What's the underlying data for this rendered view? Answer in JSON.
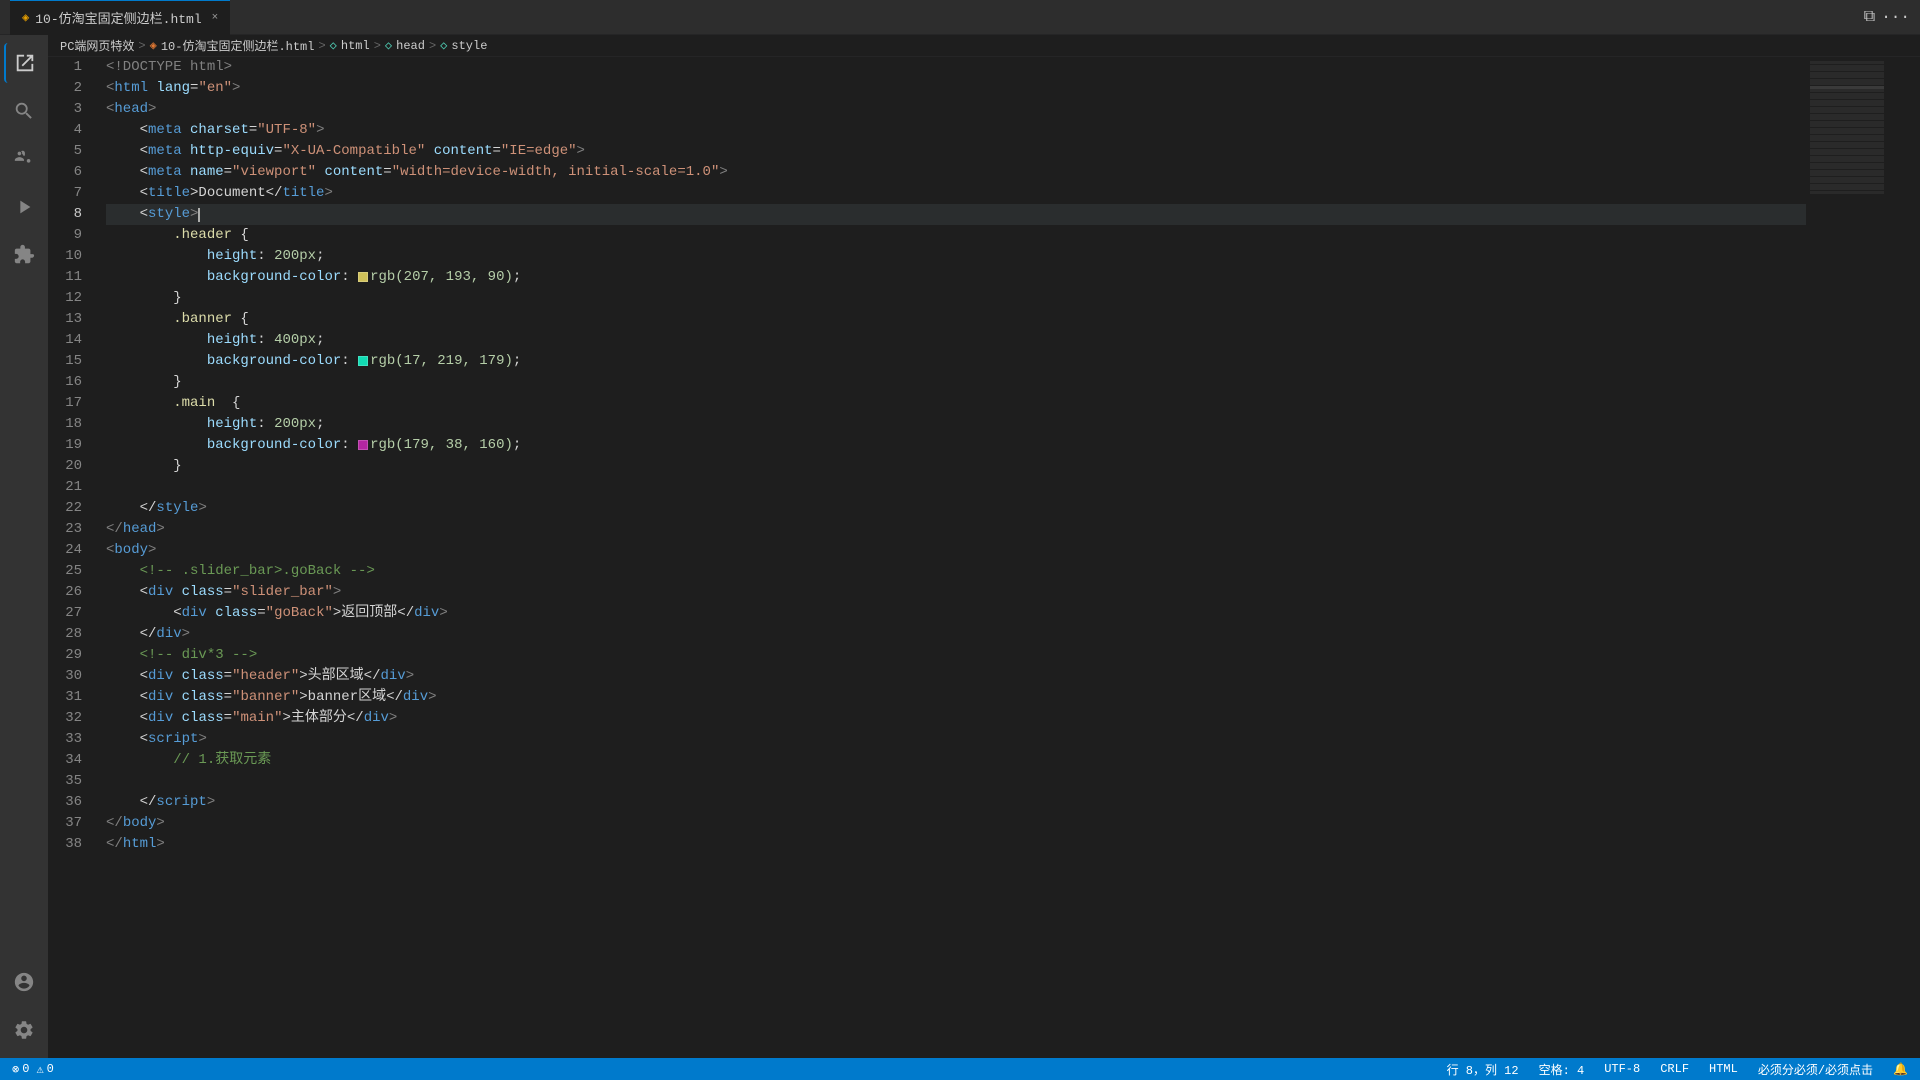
{
  "titleBar": {
    "tab": {
      "icon": "◈",
      "label": "10-仿淘宝固定侧边栏.html",
      "closeLabel": "×"
    },
    "windowControls": {
      "split": "⧉",
      "more": "···"
    }
  },
  "breadcrumb": {
    "items": [
      {
        "label": "PC端网页特效",
        "type": "folder"
      },
      {
        "label": "10-仿淘宝固定侧边栏.html",
        "type": "html"
      },
      {
        "label": "html",
        "type": "tag"
      },
      {
        "label": "head",
        "type": "tag"
      },
      {
        "label": "style",
        "type": "tag"
      }
    ]
  },
  "activityBar": {
    "icons": [
      {
        "name": "files-icon",
        "symbol": "⎗",
        "active": true
      },
      {
        "name": "search-icon",
        "symbol": "🔍"
      },
      {
        "name": "source-control-icon",
        "symbol": "⑂"
      },
      {
        "name": "run-icon",
        "symbol": "▶"
      },
      {
        "name": "extensions-icon",
        "symbol": "⊞"
      }
    ],
    "bottomIcons": [
      {
        "name": "account-icon",
        "symbol": "👤"
      },
      {
        "name": "settings-icon",
        "symbol": "⚙"
      }
    ]
  },
  "statusBar": {
    "left": {
      "errors": "⊗ 0",
      "warnings": "⚠ 0"
    },
    "right": {
      "line": "行 8，列 12",
      "spaces": "空格: 4",
      "encoding": "UTF-8",
      "crlf": "CRLF",
      "language": "HTML",
      "feedback": "必须分必须/必须点击",
      "notifications": "🔔"
    }
  },
  "lines": [
    {
      "num": 1,
      "tokens": [
        {
          "text": "<!DOCTYPE html>",
          "class": "t-gray"
        }
      ]
    },
    {
      "num": 2,
      "tokens": [
        {
          "text": "<",
          "class": "t-gray"
        },
        {
          "text": "html",
          "class": "t-blue"
        },
        {
          "text": " ",
          "class": "t-white"
        },
        {
          "text": "lang",
          "class": "t-attr"
        },
        {
          "text": "=",
          "class": "t-white"
        },
        {
          "text": "\"en\"",
          "class": "t-val"
        },
        {
          "text": ">",
          "class": "t-gray"
        }
      ]
    },
    {
      "num": 3,
      "tokens": [
        {
          "text": "<",
          "class": "t-gray"
        },
        {
          "text": "head",
          "class": "t-blue"
        },
        {
          "text": ">",
          "class": "t-gray"
        }
      ]
    },
    {
      "num": 4,
      "tokens": [
        {
          "text": "    <",
          "class": "t-white"
        },
        {
          "text": "meta",
          "class": "t-blue"
        },
        {
          "text": " ",
          "class": "t-white"
        },
        {
          "text": "charset",
          "class": "t-attr"
        },
        {
          "text": "=",
          "class": "t-white"
        },
        {
          "text": "\"UTF-8\"",
          "class": "t-val"
        },
        {
          "text": ">",
          "class": "t-gray"
        }
      ]
    },
    {
      "num": 5,
      "tokens": [
        {
          "text": "    <",
          "class": "t-white"
        },
        {
          "text": "meta",
          "class": "t-blue"
        },
        {
          "text": " ",
          "class": "t-white"
        },
        {
          "text": "http-equiv",
          "class": "t-attr"
        },
        {
          "text": "=",
          "class": "t-white"
        },
        {
          "text": "\"X-UA-Compatible\"",
          "class": "t-val"
        },
        {
          "text": " ",
          "class": "t-white"
        },
        {
          "text": "content",
          "class": "t-attr"
        },
        {
          "text": "=",
          "class": "t-white"
        },
        {
          "text": "\"IE=edge\"",
          "class": "t-val"
        },
        {
          "text": ">",
          "class": "t-gray"
        }
      ]
    },
    {
      "num": 6,
      "tokens": [
        {
          "text": "    <",
          "class": "t-white"
        },
        {
          "text": "meta",
          "class": "t-blue"
        },
        {
          "text": " ",
          "class": "t-white"
        },
        {
          "text": "name",
          "class": "t-attr"
        },
        {
          "text": "=",
          "class": "t-white"
        },
        {
          "text": "\"viewport\"",
          "class": "t-val"
        },
        {
          "text": " ",
          "class": "t-white"
        },
        {
          "text": "content",
          "class": "t-attr"
        },
        {
          "text": "=",
          "class": "t-white"
        },
        {
          "text": "\"width=device-width, initial-scale=1.0\"",
          "class": "t-val"
        },
        {
          "text": ">",
          "class": "t-gray"
        }
      ]
    },
    {
      "num": 7,
      "tokens": [
        {
          "text": "    <",
          "class": "t-white"
        },
        {
          "text": "title",
          "class": "t-blue"
        },
        {
          "text": ">Document</",
          "class": "t-white"
        },
        {
          "text": "title",
          "class": "t-blue"
        },
        {
          "text": ">",
          "class": "t-gray"
        }
      ]
    },
    {
      "num": 8,
      "tokens": [
        {
          "text": "    <",
          "class": "t-white"
        },
        {
          "text": "style",
          "class": "t-blue"
        },
        {
          "text": ">",
          "class": "t-gray"
        },
        {
          "text": "CURSOR",
          "class": "cursor-marker"
        }
      ],
      "active": true
    },
    {
      "num": 9,
      "tokens": [
        {
          "text": "        ",
          "class": "t-white"
        },
        {
          "text": ".header",
          "class": "t-yellow"
        },
        {
          "text": " {",
          "class": "t-white"
        }
      ]
    },
    {
      "num": 10,
      "tokens": [
        {
          "text": "            ",
          "class": "t-white"
        },
        {
          "text": "height",
          "class": "t-prop"
        },
        {
          "text": ": ",
          "class": "t-white"
        },
        {
          "text": "200px",
          "class": "t-num"
        },
        {
          "text": ";",
          "class": "t-white"
        }
      ]
    },
    {
      "num": 11,
      "tokens": [
        {
          "text": "            ",
          "class": "t-white"
        },
        {
          "text": "background-color",
          "class": "t-prop"
        },
        {
          "text": ": ",
          "class": "t-white"
        },
        {
          "text": "SWATCH_YELLOW",
          "class": "swatch-yellow"
        },
        {
          "text": "rgb(207, 193, 90)",
          "class": "t-num"
        },
        {
          "text": ";",
          "class": "t-white"
        }
      ]
    },
    {
      "num": 12,
      "tokens": [
        {
          "text": "        }",
          "class": "t-white"
        }
      ]
    },
    {
      "num": 13,
      "tokens": [
        {
          "text": "        ",
          "class": "t-white"
        },
        {
          "text": ".banner",
          "class": "t-yellow"
        },
        {
          "text": " {",
          "class": "t-white"
        }
      ]
    },
    {
      "num": 14,
      "tokens": [
        {
          "text": "            ",
          "class": "t-white"
        },
        {
          "text": "height",
          "class": "t-prop"
        },
        {
          "text": ": ",
          "class": "t-white"
        },
        {
          "text": "400px",
          "class": "t-num"
        },
        {
          "text": ";",
          "class": "t-white"
        }
      ]
    },
    {
      "num": 15,
      "tokens": [
        {
          "text": "            ",
          "class": "t-white"
        },
        {
          "text": "background-color",
          "class": "t-prop"
        },
        {
          "text": ": ",
          "class": "t-white"
        },
        {
          "text": "SWATCH_GREEN",
          "class": "swatch-green"
        },
        {
          "text": "rgb(17, 219, 179)",
          "class": "t-num"
        },
        {
          "text": ";",
          "class": "t-white"
        }
      ]
    },
    {
      "num": 16,
      "tokens": [
        {
          "text": "        }",
          "class": "t-white"
        }
      ]
    },
    {
      "num": 17,
      "tokens": [
        {
          "text": "        ",
          "class": "t-white"
        },
        {
          "text": ".main",
          "class": "t-yellow"
        },
        {
          "text": "  {",
          "class": "t-white"
        }
      ]
    },
    {
      "num": 18,
      "tokens": [
        {
          "text": "            ",
          "class": "t-white"
        },
        {
          "text": "height",
          "class": "t-prop"
        },
        {
          "text": ": ",
          "class": "t-white"
        },
        {
          "text": "200px",
          "class": "t-num"
        },
        {
          "text": ";",
          "class": "t-white"
        }
      ]
    },
    {
      "num": 19,
      "tokens": [
        {
          "text": "            ",
          "class": "t-white"
        },
        {
          "text": "background-color",
          "class": "t-prop"
        },
        {
          "text": ": ",
          "class": "t-white"
        },
        {
          "text": "SWATCH_PINK",
          "class": "swatch-pink"
        },
        {
          "text": "rgb(179, 38, 160)",
          "class": "t-num"
        },
        {
          "text": ";",
          "class": "t-white"
        }
      ]
    },
    {
      "num": 20,
      "tokens": [
        {
          "text": "        }",
          "class": "t-white"
        }
      ]
    },
    {
      "num": 21,
      "tokens": []
    },
    {
      "num": 22,
      "tokens": [
        {
          "text": "    </",
          "class": "t-white"
        },
        {
          "text": "style",
          "class": "t-blue"
        },
        {
          "text": ">",
          "class": "t-gray"
        }
      ]
    },
    {
      "num": 23,
      "tokens": [
        {
          "text": "</",
          "class": "t-gray"
        },
        {
          "text": "head",
          "class": "t-blue"
        },
        {
          "text": ">",
          "class": "t-gray"
        }
      ]
    },
    {
      "num": 24,
      "tokens": [
        {
          "text": "<",
          "class": "t-gray"
        },
        {
          "text": "body",
          "class": "t-blue"
        },
        {
          "text": ">",
          "class": "t-gray"
        }
      ]
    },
    {
      "num": 25,
      "tokens": [
        {
          "text": "    ",
          "class": "t-white"
        },
        {
          "text": "<!-- .slider_bar>.goBack -->",
          "class": "t-comment"
        }
      ]
    },
    {
      "num": 26,
      "tokens": [
        {
          "text": "    <",
          "class": "t-white"
        },
        {
          "text": "div",
          "class": "t-blue"
        },
        {
          "text": " ",
          "class": "t-white"
        },
        {
          "text": "class",
          "class": "t-attr"
        },
        {
          "text": "=",
          "class": "t-white"
        },
        {
          "text": "\"slider_bar\"",
          "class": "t-val"
        },
        {
          "text": ">",
          "class": "t-gray"
        }
      ]
    },
    {
      "num": 27,
      "tokens": [
        {
          "text": "        <",
          "class": "t-white"
        },
        {
          "text": "div",
          "class": "t-blue"
        },
        {
          "text": " ",
          "class": "t-white"
        },
        {
          "text": "class",
          "class": "t-attr"
        },
        {
          "text": "=",
          "class": "t-white"
        },
        {
          "text": "\"goBack\"",
          "class": "t-val"
        },
        {
          "text": ">返回顶部</",
          "class": "t-white"
        },
        {
          "text": "div",
          "class": "t-blue"
        },
        {
          "text": ">",
          "class": "t-gray"
        }
      ]
    },
    {
      "num": 28,
      "tokens": [
        {
          "text": "    </",
          "class": "t-white"
        },
        {
          "text": "div",
          "class": "t-blue"
        },
        {
          "text": ">",
          "class": "t-gray"
        }
      ]
    },
    {
      "num": 29,
      "tokens": [
        {
          "text": "    ",
          "class": "t-white"
        },
        {
          "text": "<!-- div*3 -->",
          "class": "t-comment"
        }
      ]
    },
    {
      "num": 30,
      "tokens": [
        {
          "text": "    <",
          "class": "t-white"
        },
        {
          "text": "div",
          "class": "t-blue"
        },
        {
          "text": " ",
          "class": "t-white"
        },
        {
          "text": "class",
          "class": "t-attr"
        },
        {
          "text": "=",
          "class": "t-white"
        },
        {
          "text": "\"header\"",
          "class": "t-val"
        },
        {
          "text": ">头部区域</",
          "class": "t-white"
        },
        {
          "text": "div",
          "class": "t-blue"
        },
        {
          "text": ">",
          "class": "t-gray"
        }
      ]
    },
    {
      "num": 31,
      "tokens": [
        {
          "text": "    <",
          "class": "t-white"
        },
        {
          "text": "div",
          "class": "t-blue"
        },
        {
          "text": " ",
          "class": "t-white"
        },
        {
          "text": "class",
          "class": "t-attr"
        },
        {
          "text": "=",
          "class": "t-white"
        },
        {
          "text": "\"banner\"",
          "class": "t-val"
        },
        {
          "text": ">banner区域</",
          "class": "t-white"
        },
        {
          "text": "div",
          "class": "t-blue"
        },
        {
          "text": ">",
          "class": "t-gray"
        }
      ]
    },
    {
      "num": 32,
      "tokens": [
        {
          "text": "    <",
          "class": "t-white"
        },
        {
          "text": "div",
          "class": "t-blue"
        },
        {
          "text": " ",
          "class": "t-white"
        },
        {
          "text": "class",
          "class": "t-attr"
        },
        {
          "text": "=",
          "class": "t-white"
        },
        {
          "text": "\"main\"",
          "class": "t-val"
        },
        {
          "text": ">主体部分</",
          "class": "t-white"
        },
        {
          "text": "div",
          "class": "t-blue"
        },
        {
          "text": ">",
          "class": "t-gray"
        }
      ]
    },
    {
      "num": 33,
      "tokens": [
        {
          "text": "    <",
          "class": "t-white"
        },
        {
          "text": "script",
          "class": "t-blue"
        },
        {
          "text": ">",
          "class": "t-gray"
        }
      ]
    },
    {
      "num": 34,
      "tokens": [
        {
          "text": "        ",
          "class": "t-white"
        },
        {
          "text": "// 1.获取元素",
          "class": "t-comment"
        }
      ]
    },
    {
      "num": 35,
      "tokens": []
    },
    {
      "num": 36,
      "tokens": [
        {
          "text": "    </",
          "class": "t-white"
        },
        {
          "text": "script",
          "class": "t-blue"
        },
        {
          "text": ">",
          "class": "t-gray"
        }
      ]
    },
    {
      "num": 37,
      "tokens": [
        {
          "text": "</",
          "class": "t-gray"
        },
        {
          "text": "body",
          "class": "t-blue"
        },
        {
          "text": ">",
          "class": "t-gray"
        }
      ]
    },
    {
      "num": 38,
      "tokens": [
        {
          "text": "</",
          "class": "t-gray"
        },
        {
          "text": "html",
          "class": "t-blue"
        },
        {
          "text": ">",
          "class": "t-gray"
        }
      ]
    }
  ]
}
